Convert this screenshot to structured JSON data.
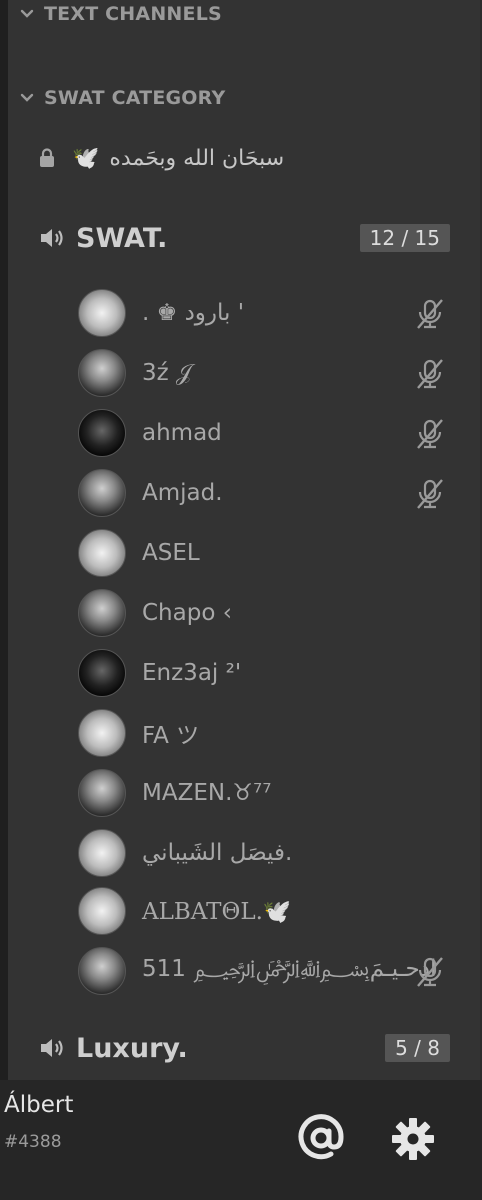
{
  "categories": [
    {
      "name": "TEXT CHANNELS"
    },
    {
      "name": "SWAT CATEGORY"
    }
  ],
  "text_channel": {
    "name": "سبحَان الله وبحَمده",
    "emoji": "🕊️",
    "icon": "lock-icon"
  },
  "voice_channels": [
    {
      "name": "SWAT.",
      "count": "12 / 15",
      "icon": "speaker-icon",
      "users": [
        {
          "name": ". ♚ بارود '",
          "muted": true
        },
        {
          "name": "3ź 𝒥",
          "muted": true
        },
        {
          "name": "ahmad",
          "muted": true
        },
        {
          "name": "Amjad.",
          "muted": true
        },
        {
          "name": "ASEL",
          "muted": false
        },
        {
          "name": "Chapo ‹",
          "muted": false
        },
        {
          "name": "Enz3aj ²'",
          "muted": false
        },
        {
          "name": "FA ツ",
          "muted": false
        },
        {
          "name": "MAZEN.♉⁷⁷",
          "muted": false
        },
        {
          "name": "فيصَل الشَيباني.",
          "muted": false
        },
        {
          "name": "ALBATΘL.🕊️",
          "muted": false
        },
        {
          "name": "511 ﷽ادحـيـمَ",
          "muted": true
        }
      ]
    },
    {
      "name": "Luxury.",
      "count": "5 / 8",
      "icon": "speaker-icon"
    }
  ],
  "footer": {
    "username": "Álbert",
    "tag": "#4388",
    "mention_icon": "at-icon",
    "settings_icon": "gear-icon"
  },
  "colors": {
    "panel": "#333333",
    "background": "#2c2c2c",
    "footer": "#262626",
    "badge": "#555555"
  }
}
